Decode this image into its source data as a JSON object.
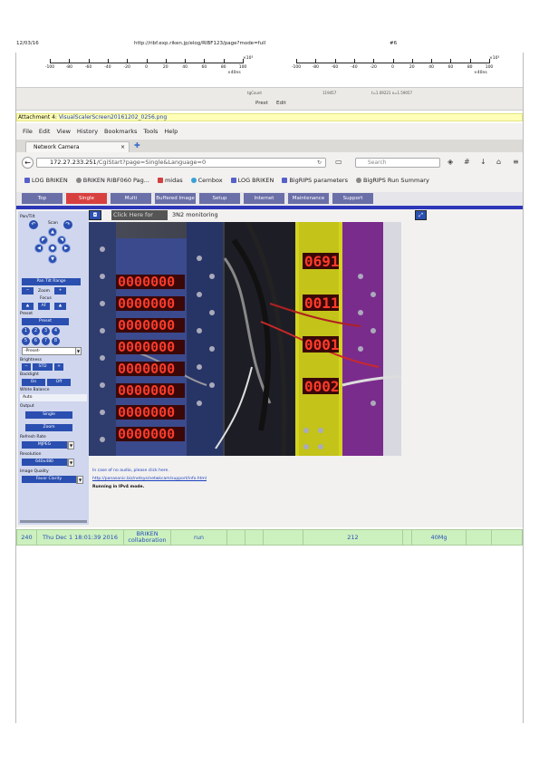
{
  "page_header": {
    "date": "12/03/16",
    "url": "http://ribf.exp.riken.jp/elog/RIBF123/page?mode=full",
    "page_number": "#6"
  },
  "axis_left": {
    "tick_labels": [
      "-100",
      "-80",
      "-60",
      "-40",
      "-20",
      "0",
      "20",
      "40",
      "60",
      "80",
      "100"
    ],
    "exponent": "×10³",
    "unit": "×40ns"
  },
  "axis_right": {
    "tick_labels": [
      "-100",
      "-80",
      "-60",
      "-40",
      "-20",
      "0",
      "20",
      "40",
      "60",
      "80",
      "100"
    ],
    "exponent": "×10³",
    "unit": "×40ns"
  },
  "entry_footer": {
    "small_texts": [
      "tgCount",
      "119457",
      "t=1.09221 x=1.59057"
    ],
    "links": [
      "Prest",
      "Edit"
    ]
  },
  "attachment": {
    "label": "Attachment 4:",
    "filename": "VisualScalerScreen20161202_0256.png"
  },
  "browser": {
    "menu": [
      "File",
      "Edit",
      "View",
      "History",
      "Bookmarks",
      "Tools",
      "Help"
    ],
    "tab_title": "Network Camera",
    "url_ip": "172.27.233.251",
    "url_path": "/CgiStart?page=Single&Language=0",
    "search_placeholder": "Search",
    "bookmarks": [
      "LOG BRIKEN",
      "BRIKEN RIBF060 Pag...",
      "midas",
      "Cernbox",
      "LOG BRIKEN",
      "BigRIPS parameters",
      "BigRIPS Run Summary"
    ]
  },
  "camera_ui": {
    "tabs": [
      "Top",
      "Single",
      "Multi",
      "Buffered Image",
      "Setup",
      "Internet",
      "Maintenance",
      "Support"
    ],
    "active_tab": "Single",
    "click_here_label": "Click Here for",
    "title_suffix": "3N2 monitoring",
    "left_panel": {
      "pan_tilt": "Pan/Tilt",
      "scan": "Scan",
      "pan_tilt_range": "Pan Tilt Range",
      "zoom": "Zoom",
      "focus": "Focus",
      "af": "AF",
      "preset": "Preset",
      "preset_btn": "Preset",
      "preset_numbers": [
        "1",
        "2",
        "3",
        "4",
        "5",
        "6",
        "7",
        "8"
      ],
      "preset_select": "-Preset-",
      "brightness": "Brightness",
      "std": "STD",
      "backlight": "Backlight",
      "on": "On",
      "off": "Off",
      "white_balance": "White Balance",
      "auto": "Auto",
      "output": "Output",
      "output_btn1": "Single",
      "output_btn2": "Zoom",
      "refresh_rate": "Refresh Rate",
      "refresh_value": "MJPEG",
      "resolution": "Resolution",
      "resolution_value": "640x480",
      "image_quality": "Image Quality",
      "image_quality_value": "Favor Clarity"
    },
    "below_text_1": "In case of no audio, please click here.",
    "below_link": "http://panasonic.biz/netsys/netwkcam/support/info.html",
    "below_text_2": "Running in IPv4 mode.",
    "displays_left": [
      "0000000",
      "0000000",
      "0000000",
      "0000000",
      "0000000",
      "0000000",
      "0000000",
      "0000000"
    ],
    "displays_right": [
      "0691",
      "0011",
      "0001",
      "0002"
    ]
  },
  "run_row": {
    "cells": [
      "240",
      "Thu Dec 1 18:01:39 2016",
      "BRIKEN collaboration",
      "run",
      "",
      "",
      "",
      "212",
      "",
      "40Mg",
      "",
      ""
    ]
  },
  "colors": {
    "attachment_bg": "#ffffb8",
    "run_row_bg": "#cdf0bf",
    "camera_tab": "#6a6fa8",
    "camera_tab_active": "#d84040",
    "accent_blue": "#2e36b8"
  }
}
